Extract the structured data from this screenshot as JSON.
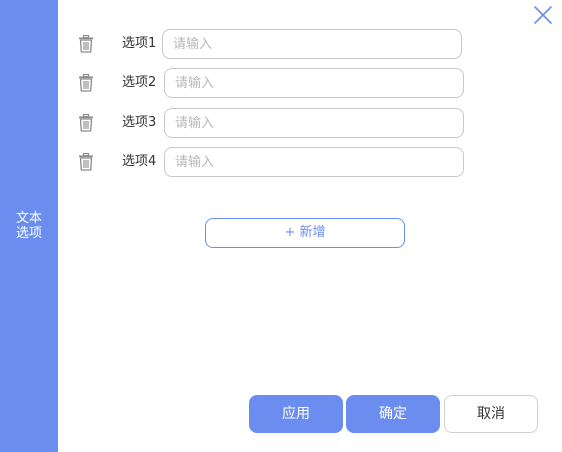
{
  "colors": {
    "accent": "#6b8def",
    "input_border": "#c8c8c8",
    "placeholder": "#b8b8b8",
    "icon_gray": "#8a8a8a"
  },
  "side_tab": {
    "label": "文本选项"
  },
  "close_icon": "close-icon",
  "options": [
    {
      "label": "选项1",
      "placeholder": "请输入",
      "value": ""
    },
    {
      "label": "选项2",
      "placeholder": "请输入",
      "value": ""
    },
    {
      "label": "选项3",
      "placeholder": "请输入",
      "value": ""
    },
    {
      "label": "选项4",
      "placeholder": "请输入",
      "value": ""
    }
  ],
  "add_button": {
    "label": "+ 新增"
  },
  "footer": {
    "apply_label": "应用",
    "confirm_label": "确定",
    "cancel_label": "取消"
  }
}
